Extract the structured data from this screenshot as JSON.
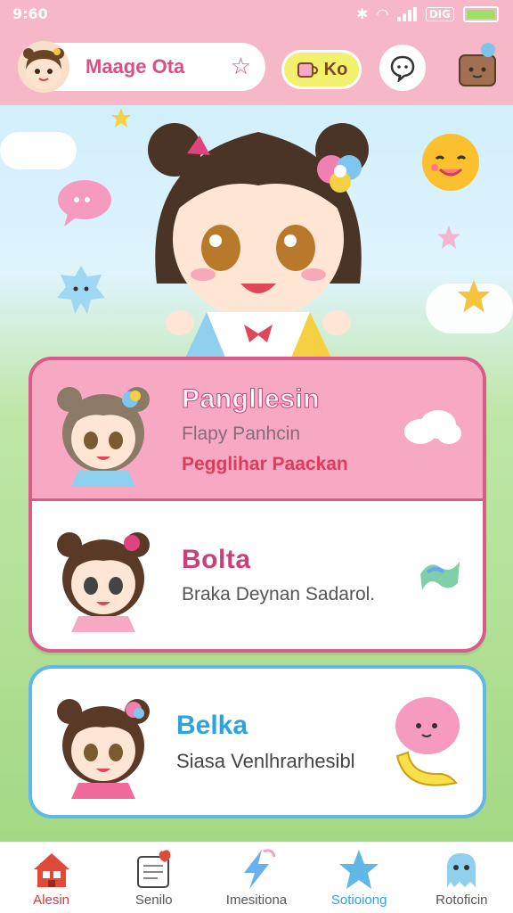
{
  "status_bar": {
    "time": "9:60",
    "battery_label": "DIG"
  },
  "header": {
    "title": "Maage Ota",
    "ko_label": "Ko"
  },
  "cards": [
    {
      "name": "Pangllesin",
      "subtitle": "Flapy Panhcin",
      "tag": "Pegglihar Paackan",
      "name_color": "#c9407a"
    },
    {
      "name": "Bolta",
      "subtitle": "Braka Deynan Sadarol.",
      "name_color": "#c9407a"
    },
    {
      "name": "Belka",
      "subtitle": "Siasa Venlhrarhesibl",
      "name_color": "#2aa4e0"
    }
  ],
  "bottom_nav": [
    {
      "label": "Alesin",
      "icon": "house-icon"
    },
    {
      "label": "Senilo",
      "icon": "notebook-icon"
    },
    {
      "label": "Imesitiona",
      "icon": "lightning-icon"
    },
    {
      "label": "Sotioiong",
      "icon": "star-icon"
    },
    {
      "label": "Rotoficin",
      "icon": "ghost-icon"
    }
  ],
  "colors": {
    "header": "#f6b7c8",
    "accent_pink": "#d85b8a",
    "accent_blue": "#2aa4e0"
  }
}
